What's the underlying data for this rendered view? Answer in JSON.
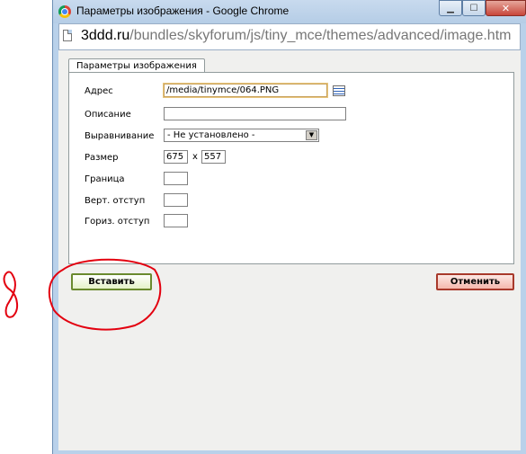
{
  "window": {
    "title": "Параметры изображения - Google Chrome",
    "controls": {
      "minimize": "▁",
      "maximize": "☐",
      "close": "✕"
    }
  },
  "addressbar": {
    "url_domain": "3ddd.ru",
    "url_path": "/bundles/skyforum/js/tiny_mce/themes/advanced/image.htm"
  },
  "dialog": {
    "tab_label": "Параметры изображения",
    "fields": {
      "address_label": "Адрес",
      "address_value": "/media/tinymce/064.PNG",
      "description_label": "Описание",
      "description_value": "",
      "align_label": "Выравнивание",
      "align_value": "- Не установлено -",
      "size_label": "Размер",
      "width_value": "675",
      "size_separator": "x",
      "height_value": "557",
      "border_label": "Граница",
      "border_value": "",
      "vspace_label": "Верт. отступ",
      "vspace_value": "",
      "hspace_label": "Гориз. отступ",
      "hspace_value": ""
    },
    "buttons": {
      "insert": "Вставить",
      "cancel": "Отменить"
    }
  },
  "colors": {
    "annotation_red": "#e3000f",
    "insert_border": "#6a8a2e",
    "cancel_border": "#a8392b"
  },
  "icons": [
    "chrome-icon",
    "page-icon",
    "browse-icon",
    "chevron-down-icon"
  ]
}
